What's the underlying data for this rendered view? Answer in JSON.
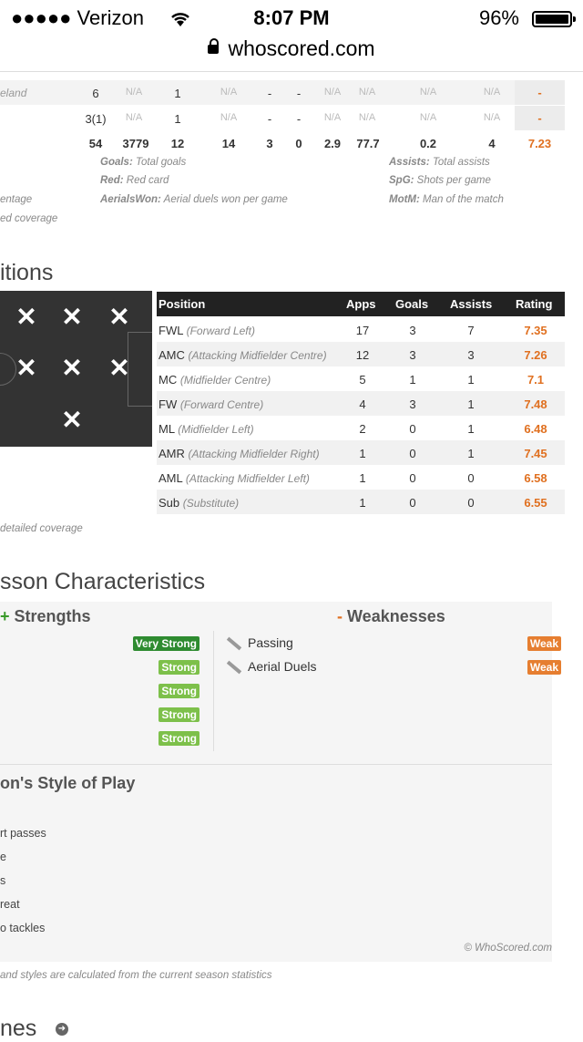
{
  "status_bar": {
    "carrier": "●●●●● Verizon",
    "time": "8:07 PM",
    "battery": "96%",
    "battery_level": 0.96
  },
  "browser": {
    "url": "whoscored.com"
  },
  "stats_table": {
    "rows": [
      {
        "name": "eland",
        "apps": "6",
        "mins": "N/A",
        "goals": "1",
        "c4": "N/A",
        "c5": "-",
        "c6": "-",
        "c7": "N/A",
        "c8": "N/A",
        "c9": "N/A",
        "c10": "N/A",
        "rating": "-"
      },
      {
        "name": "",
        "apps": "3(1)",
        "mins": "N/A",
        "goals": "1",
        "c4": "N/A",
        "c5": "-",
        "c6": "-",
        "c7": "N/A",
        "c8": "N/A",
        "c9": "N/A",
        "c10": "N/A",
        "rating": "-"
      },
      {
        "name": "",
        "apps": "54",
        "mins": "3779",
        "goals": "12",
        "c4": "14",
        "c5": "3",
        "c6": "0",
        "c7": "2.9",
        "c8": "77.7",
        "c9": "0.2",
        "c10": "4",
        "rating": "7.23"
      }
    ],
    "legend": {
      "goals_k": "Goals:",
      "goals_v": " Total goals",
      "red_k": "Red:",
      "red_v": " Red card",
      "aerials_k": "AerialsWon:",
      "aerials_v": " Aerial duels won per game",
      "assists_k": "Assists:",
      "assists_v": " Total assists",
      "spg_k": "SpG:",
      "spg_v": " Shots per game",
      "motm_k": "MotM:",
      "motm_v": " Man of the match",
      "left1": "entage",
      "left2": "ed coverage"
    }
  },
  "positions": {
    "title": "itions",
    "headers": {
      "position": "Position",
      "apps": "Apps",
      "goals": "Goals",
      "assists": "Assists",
      "rating": "Rating"
    },
    "rows": [
      {
        "code": "FWL",
        "desc": "(Forward Left)",
        "apps": "17",
        "goals": "3",
        "assists": "7",
        "rating": "7.35"
      },
      {
        "code": "AMC",
        "desc": "(Attacking Midfielder Centre)",
        "apps": "12",
        "goals": "3",
        "assists": "3",
        "rating": "7.26"
      },
      {
        "code": "MC",
        "desc": "(Midfielder Centre)",
        "apps": "5",
        "goals": "1",
        "assists": "1",
        "rating": "7.1"
      },
      {
        "code": "FW",
        "desc": "(Forward Centre)",
        "apps": "4",
        "goals": "3",
        "assists": "1",
        "rating": "7.48"
      },
      {
        "code": "ML",
        "desc": "(Midfielder Left)",
        "apps": "2",
        "goals": "0",
        "assists": "1",
        "rating": "6.48"
      },
      {
        "code": "AMR",
        "desc": "(Attacking Midfielder Right)",
        "apps": "1",
        "goals": "0",
        "assists": "1",
        "rating": "7.45"
      },
      {
        "code": "AML",
        "desc": "(Attacking Midfielder Left)",
        "apps": "1",
        "goals": "0",
        "assists": "0",
        "rating": "6.58"
      },
      {
        "code": "Sub",
        "desc": "(Substitute)",
        "apps": "1",
        "goals": "0",
        "assists": "0",
        "rating": "6.55"
      }
    ],
    "footnote": "detailed coverage",
    "marker": "✕"
  },
  "characteristics": {
    "title": "sson Characteristics",
    "strengths_label": "Strengths",
    "strengths_sign": "+",
    "weaknesses_label": "Weaknesses",
    "weaknesses_sign": "-",
    "strength_tags": [
      "Very Strong",
      "Strong",
      "Strong",
      "Strong",
      "Strong"
    ],
    "weaknesses": [
      {
        "name": "Passing",
        "level": "Weak"
      },
      {
        "name": "Aerial Duels",
        "level": "Weak"
      }
    ],
    "style_title": "on's Style of Play",
    "style_items": [
      "rt passes",
      "e",
      "s",
      "reat",
      "o tackles"
    ],
    "copyright": "© WhoScored.com",
    "note": "and styles are calculated from the current season statistics"
  },
  "bottom": {
    "title": "nes"
  },
  "colors": {
    "accent": "#e07020",
    "very_strong": "#2e8b30",
    "strong": "#7dc04a",
    "weak": "#e67e30",
    "header": "#222222"
  }
}
